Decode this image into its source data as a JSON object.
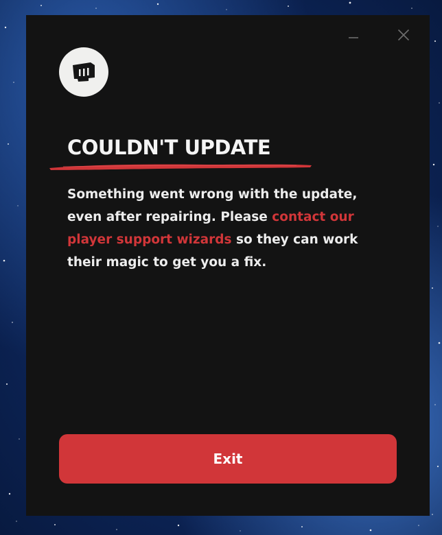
{
  "window": {
    "minimize_icon": "minimize-icon",
    "close_icon": "close-icon"
  },
  "logo": {
    "icon": "fist-logo-icon"
  },
  "dialog": {
    "title": "COULDN'T UPDATE",
    "message_before": "Something went wrong with the update, even after repairing. Please ",
    "support_link": "contact our player support wizards",
    "message_after": " so they can work their magic to get you a fix.",
    "exit_label": "Exit"
  },
  "colors": {
    "accent": "#d13639",
    "panel": "#131313",
    "text": "#ededed"
  }
}
